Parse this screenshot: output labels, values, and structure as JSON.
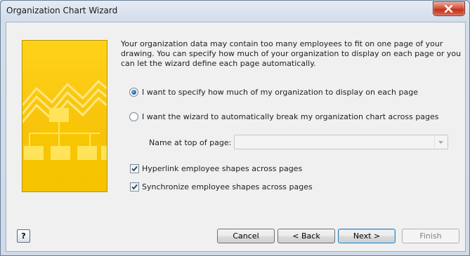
{
  "window": {
    "title": "Organization Chart Wizard",
    "close_icon": "close-icon"
  },
  "intro_text": "Your organization data may contain too many employees to fit on one page of your drawing.  You can specify how much of your organization to display on each page or you can let the wizard define each page automatically.",
  "options": {
    "specify_label": "I want to specify how much of my organization to display on each page",
    "specify_checked": true,
    "auto_break_label": "I want the wizard to automatically break my organization chart across pages",
    "auto_break_checked": false
  },
  "name_at_top": {
    "label": "Name at top of page:",
    "value": "",
    "enabled": false
  },
  "checkboxes": {
    "hyperlink_label": "Hyperlink employee shapes across pages",
    "hyperlink_checked": true,
    "synchronize_label": "Synchronize employee shapes across pages",
    "synchronize_checked": true
  },
  "buttons": {
    "help_icon": "help-icon",
    "help_symbol": "?",
    "cancel": "Cancel",
    "back": "< Back",
    "next": "Next >",
    "finish": "Finish"
  },
  "colors": {
    "banner_yellow": "#f5c400",
    "banner_light": "#ffe34d",
    "default_button_border": "#3c7fb1"
  }
}
